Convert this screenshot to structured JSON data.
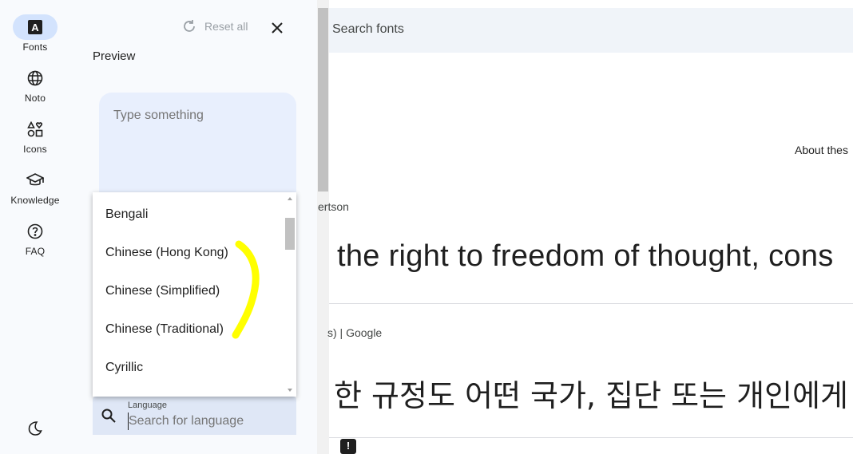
{
  "rail": {
    "items": [
      {
        "label": "Fonts",
        "icon": "fonts-icon"
      },
      {
        "label": "Noto",
        "icon": "globe-icon"
      },
      {
        "label": "Icons",
        "icon": "shapes-icon"
      },
      {
        "label": "Knowledge",
        "icon": "school-icon"
      },
      {
        "label": "FAQ",
        "icon": "help-icon"
      }
    ],
    "theme_icon": "dark-mode-icon"
  },
  "panel": {
    "reset_label": "Reset all",
    "preview_title": "Preview",
    "preview_placeholder": "Type something",
    "language_label": "Language",
    "language_placeholder": "Search for language"
  },
  "dropdown": {
    "options": [
      "Bengali",
      "Chinese (Hong Kong)",
      "Chinese (Simplified)",
      "Chinese (Traditional)",
      "Cyrillic"
    ]
  },
  "main": {
    "search_placeholder": "Search fonts",
    "about_text": "About thes",
    "designer_fragment": "ertson",
    "sample_text_1": "the right to freedom of thought, cons",
    "meta_fragment": "s)  |  Google",
    "sample_text_2": "한 규정도 어떤 국가, 집단 또는 개인에게"
  },
  "colors": {
    "accent": "#d3e3fd",
    "highlight": "#ffff00",
    "panel_bg": "#f8fafd"
  }
}
